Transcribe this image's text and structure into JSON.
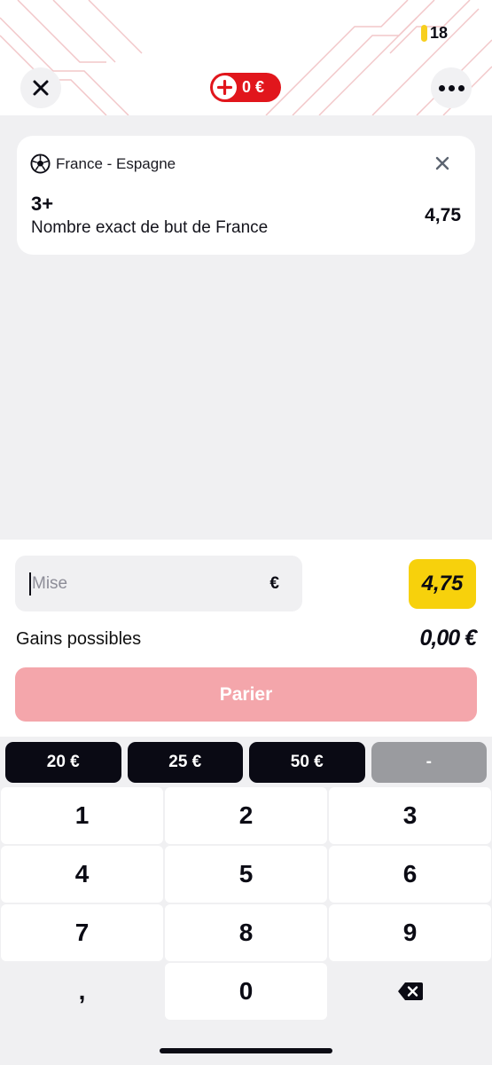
{
  "status": {
    "badge_number": "18"
  },
  "header": {
    "balance": "0 €"
  },
  "bet": {
    "match": "France - Espagne",
    "selection": "3+",
    "market": "Nombre exact de but de France",
    "odds": "4,75"
  },
  "stake": {
    "placeholder": "Mise",
    "currency": "€",
    "odds_badge": "4,75",
    "gains_label": "Gains possibles",
    "gains_value": "0,00 €",
    "bet_button": "Parier"
  },
  "quick_stakes": [
    "20 €",
    "25 €",
    "50 €",
    "-"
  ],
  "keypad": {
    "rows": [
      [
        "1",
        "2",
        "3"
      ],
      [
        "4",
        "5",
        "6"
      ],
      [
        "7",
        "8",
        "9"
      ],
      [
        ",",
        "0",
        ""
      ]
    ]
  },
  "colors": {
    "brand_red": "#e1161c",
    "accent_yellow": "#f7d10c",
    "disabled_button": "#f4a6ab"
  },
  "icons": {
    "close": "close-icon",
    "more": "more-icon",
    "add": "plus-circle-icon",
    "sport": "soccer-ball-icon",
    "remove": "close-icon",
    "backspace": "backspace-icon"
  }
}
